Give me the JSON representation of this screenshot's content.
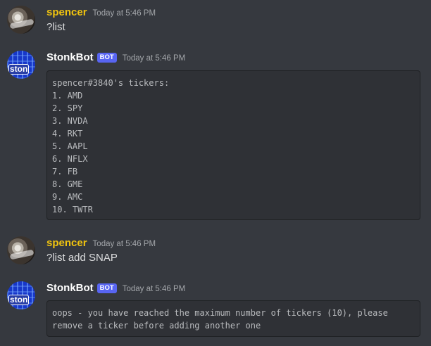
{
  "messages": [
    {
      "author": "spencer",
      "timestamp": "Today at 5:46 PM",
      "text": "?list"
    },
    {
      "author": "StonkBot",
      "bot_tag": "BOT",
      "timestamp": "Today at 5:46 PM",
      "avatar_text": "ston",
      "code_lines": [
        "spencer#3840's tickers:",
        "1. AMD",
        "2. SPY",
        "3. NVDA",
        "4. RKT",
        "5. AAPL",
        "6. NFLX",
        "7. FB",
        "8. GME",
        "9. AMC",
        "10. TWTR"
      ]
    },
    {
      "author": "spencer",
      "timestamp": "Today at 5:46 PM",
      "text": "?list add SNAP"
    },
    {
      "author": "StonkBot",
      "bot_tag": "BOT",
      "timestamp": "Today at 5:46 PM",
      "avatar_text": "ston",
      "code_lines": [
        "oops - you have reached the maximum number of tickers (10), please",
        "remove a ticker before adding another one"
      ]
    }
  ],
  "colors": {
    "background": "#36393f",
    "user_name": "#f1c40f",
    "bot_name": "#ffffff",
    "bot_tag": "#5865f2",
    "codeblock_bg": "#2f3136"
  }
}
